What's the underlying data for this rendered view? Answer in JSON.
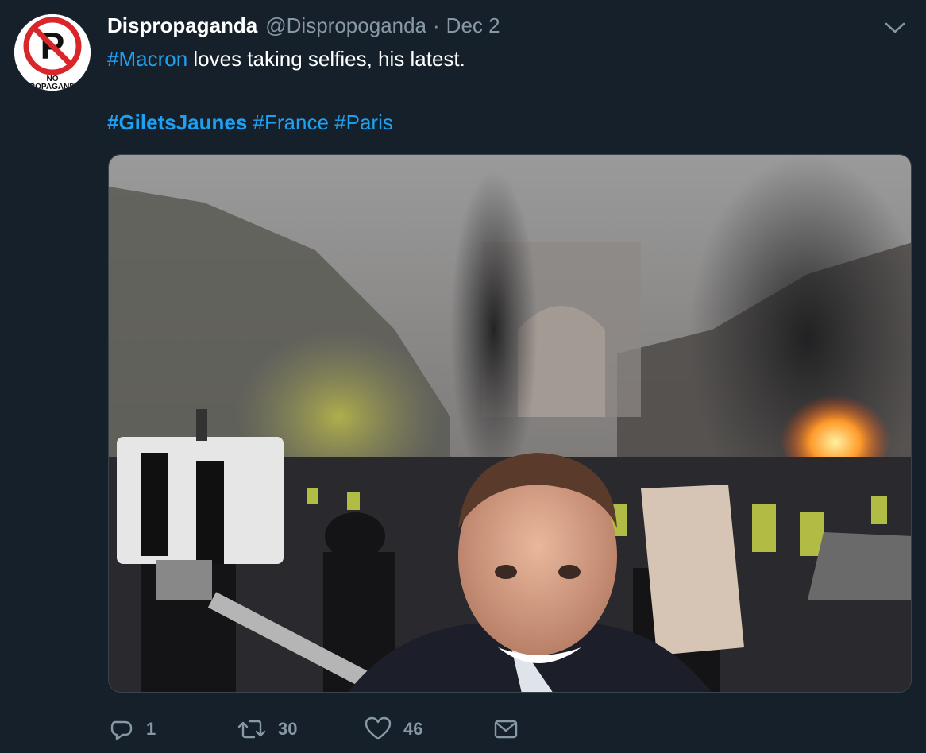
{
  "author": {
    "display_name": "Dispropaganda",
    "handle": "@Dispropoganda",
    "separator": "·",
    "date": "Dec 2",
    "avatar_icon": "no-propaganda-logo",
    "avatar_text_top": "NO",
    "avatar_text_bottom": "PROPAGANDA"
  },
  "tweet": {
    "line1_hashtag": "#Macron",
    "line1_text": " loves taking selfies, his latest.",
    "hashtags": [
      "#GiletsJaunes",
      "#France",
      "#Paris"
    ]
  },
  "media": {
    "type": "photo",
    "description_icon": "photo"
  },
  "actions": {
    "reply": {
      "icon": "reply-icon",
      "count": "1"
    },
    "retweet": {
      "icon": "retweet-icon",
      "count": "30"
    },
    "like": {
      "icon": "heart-icon",
      "count": "46"
    },
    "dm": {
      "icon": "mail-icon"
    }
  },
  "colors": {
    "background": "#15202b",
    "accent": "#1da1f2",
    "secondary_text": "#8899a6",
    "primary_text": "#ffffff"
  }
}
